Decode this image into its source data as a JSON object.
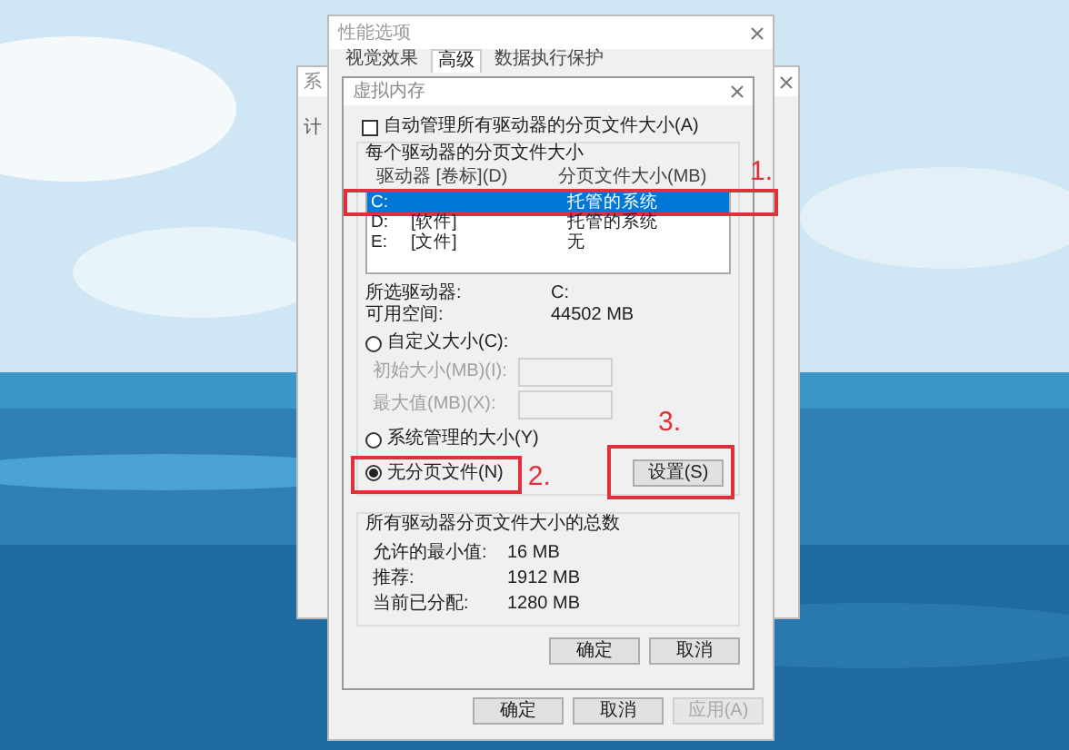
{
  "back_window": {
    "title": "系",
    "content_label": "计"
  },
  "performance_window": {
    "title": "性能选项",
    "tabs": [
      {
        "label": "视觉效果",
        "selected": false
      },
      {
        "label": "高级",
        "selected": true
      },
      {
        "label": "数据执行保护",
        "selected": false
      }
    ],
    "buttons": [
      {
        "label": "确定",
        "disabled": false
      },
      {
        "label": "取消",
        "disabled": false
      },
      {
        "label": "应用(A)",
        "disabled": true
      }
    ]
  },
  "dialog": {
    "title": "虚拟内存",
    "auto_manage": {
      "label": "自动管理所有驱动器的分页文件大小(A)",
      "checked": false
    },
    "drives_group": {
      "title": "每个驱动器的分页文件大小",
      "columns": [
        "驱动器 [卷标](D)",
        "分页文件大小(MB)"
      ],
      "rows": [
        {
          "drive": "C:",
          "label": "",
          "size": "托管的系统",
          "selected": true
        },
        {
          "drive": "D:",
          "label": "[软件]",
          "size": "托管的系统",
          "selected": false
        },
        {
          "drive": "E:",
          "label": "[文件]",
          "size": "无",
          "selected": false
        }
      ]
    },
    "info": [
      {
        "label": "所选驱动器:",
        "value": "C:"
      },
      {
        "label": "可用空间:",
        "value": "44502 MB"
      }
    ],
    "size_options": [
      {
        "label": "自定义大小(C):",
        "selected": false,
        "fields": [
          {
            "label": "初始大小(MB)(I):",
            "disabled": true
          },
          {
            "label": "最大值(MB)(X):",
            "disabled": true
          }
        ]
      },
      {
        "label": "系统管理的大小(Y)",
        "selected": false
      },
      {
        "label": "无分页文件(N)",
        "selected": true
      }
    ],
    "set_button": "设置(S)",
    "totals_group": {
      "title": "所有驱动器分页文件大小的总数",
      "rows": [
        {
          "label": "允许的最小值:",
          "value": "16 MB"
        },
        {
          "label": "推荐:",
          "value": "1912 MB"
        },
        {
          "label": "当前已分配:",
          "value": "1280 MB"
        }
      ]
    },
    "buttons": [
      "确定",
      "取消"
    ]
  },
  "annotations": [
    {
      "label": "1."
    },
    {
      "label": "2."
    },
    {
      "label": "3."
    }
  ]
}
